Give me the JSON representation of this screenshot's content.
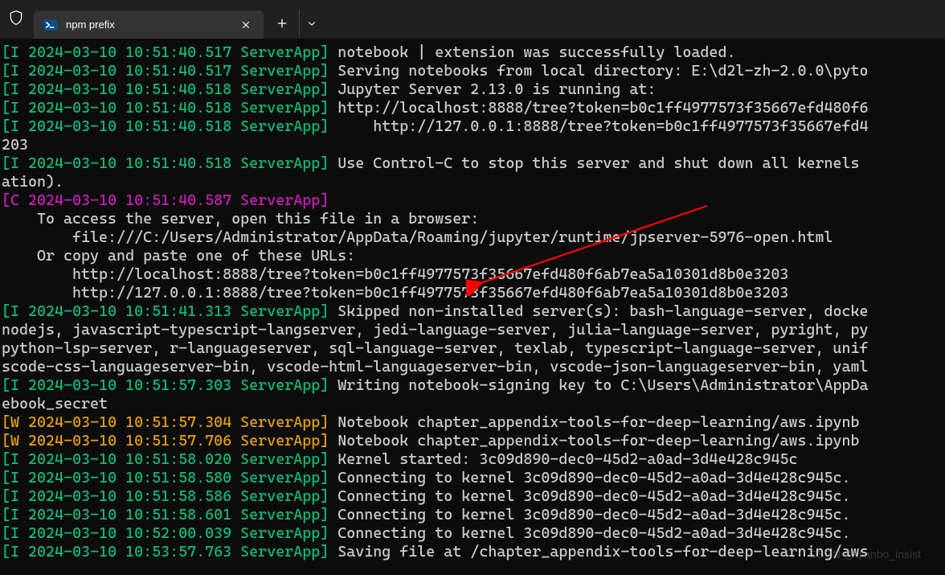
{
  "window": {
    "tab_title": "npm prefix"
  },
  "colors": {
    "background": "#0c0c0c",
    "tab_bg": "#333333",
    "titlebar_bg": "#202020",
    "info": "#0dbc79",
    "critical": "#c71fb8",
    "warning": "#e5a000",
    "text": "#cccccc"
  },
  "watermark": "CSDN @qianbo_insist",
  "log_lines": [
    {
      "level": "I",
      "ts": "2024-03-10 10:51:40.517",
      "app": "ServerApp",
      "msg": " notebook | extension was successfully loaded."
    },
    {
      "level": "I",
      "ts": "2024-03-10 10:51:40.517",
      "app": "ServerApp",
      "msg": " Serving notebooks from local directory: E:\\d2l-zh-2.0.0\\pyto"
    },
    {
      "level": "I",
      "ts": "2024-03-10 10:51:40.518",
      "app": "ServerApp",
      "msg": " Jupyter Server 2.13.0 is running at:"
    },
    {
      "level": "I",
      "ts": "2024-03-10 10:51:40.518",
      "app": "ServerApp",
      "msg": " http://localhost:8888/tree?token=b0c1ff4977573f35667efd480f6"
    },
    {
      "level": "I",
      "ts": "2024-03-10 10:51:40.518",
      "app": "ServerApp",
      "msg": "     http://127.0.0.1:8888/tree?token=b0c1ff4977573f35667efd4"
    },
    {
      "plain": "203"
    },
    {
      "level": "I",
      "ts": "2024-03-10 10:51:40.518",
      "app": "ServerApp",
      "msg": " Use Control-C to stop this server and shut down all kernels "
    },
    {
      "plain": "ation)."
    },
    {
      "level": "C",
      "ts": "2024-03-10 10:51:40.587",
      "app": "ServerApp",
      "msg": ""
    },
    {
      "plain": ""
    },
    {
      "plain": "    To access the server, open this file in a browser:"
    },
    {
      "plain": "        file:///C:/Users/Administrator/AppData/Roaming/jupyter/runtime/jpserver-5976-open.html"
    },
    {
      "plain": "    Or copy and paste one of these URLs:"
    },
    {
      "plain": "        http://localhost:8888/tree?token=b0c1ff4977573f35667efd480f6ab7ea5a10301d8b0e3203"
    },
    {
      "plain": "        http://127.0.0.1:8888/tree?token=b0c1ff4977573f35667efd480f6ab7ea5a10301d8b0e3203"
    },
    {
      "level": "I",
      "ts": "2024-03-10 10:51:41.313",
      "app": "ServerApp",
      "msg": " Skipped non-installed server(s): bash-language-server, docke"
    },
    {
      "plain": "nodejs, javascript-typescript-langserver, jedi-language-server, julia-language-server, pyright, py"
    },
    {
      "plain": "python-lsp-server, r-languageserver, sql-language-server, texlab, typescript-language-server, unif"
    },
    {
      "plain": "scode-css-languageserver-bin, vscode-html-languageserver-bin, vscode-json-languageserver-bin, yaml"
    },
    {
      "level": "I",
      "ts": "2024-03-10 10:51:57.303",
      "app": "ServerApp",
      "msg": " Writing notebook-signing key to C:\\Users\\Administrator\\AppDa"
    },
    {
      "plain": "ebook_secret"
    },
    {
      "level": "W",
      "ts": "2024-03-10 10:51:57.304",
      "app": "ServerApp",
      "msg": " Notebook chapter_appendix-tools-for-deep-learning/aws.ipynb "
    },
    {
      "level": "W",
      "ts": "2024-03-10 10:51:57.706",
      "app": "ServerApp",
      "msg": " Notebook chapter_appendix-tools-for-deep-learning/aws.ipynb "
    },
    {
      "level": "I",
      "ts": "2024-03-10 10:51:58.020",
      "app": "ServerApp",
      "msg": " Kernel started: 3c09d890-dec0-45d2-a0ad-3d4e428c945c"
    },
    {
      "level": "I",
      "ts": "2024-03-10 10:51:58.580",
      "app": "ServerApp",
      "msg": " Connecting to kernel 3c09d890-dec0-45d2-a0ad-3d4e428c945c."
    },
    {
      "level": "I",
      "ts": "2024-03-10 10:51:58.586",
      "app": "ServerApp",
      "msg": " Connecting to kernel 3c09d890-dec0-45d2-a0ad-3d4e428c945c."
    },
    {
      "level": "I",
      "ts": "2024-03-10 10:51:58.601",
      "app": "ServerApp",
      "msg": " Connecting to kernel 3c09d890-dec0-45d2-a0ad-3d4e428c945c."
    },
    {
      "level": "I",
      "ts": "2024-03-10 10:52:00.039",
      "app": "ServerApp",
      "msg": " Connecting to kernel 3c09d890-dec0-45d2-a0ad-3d4e428c945c."
    },
    {
      "level": "I",
      "ts": "2024-03-10 10:53:57.763",
      "app": "ServerApp",
      "msg": " Saving file at /chapter_appendix-tools-for-deep-learning/aws"
    }
  ]
}
